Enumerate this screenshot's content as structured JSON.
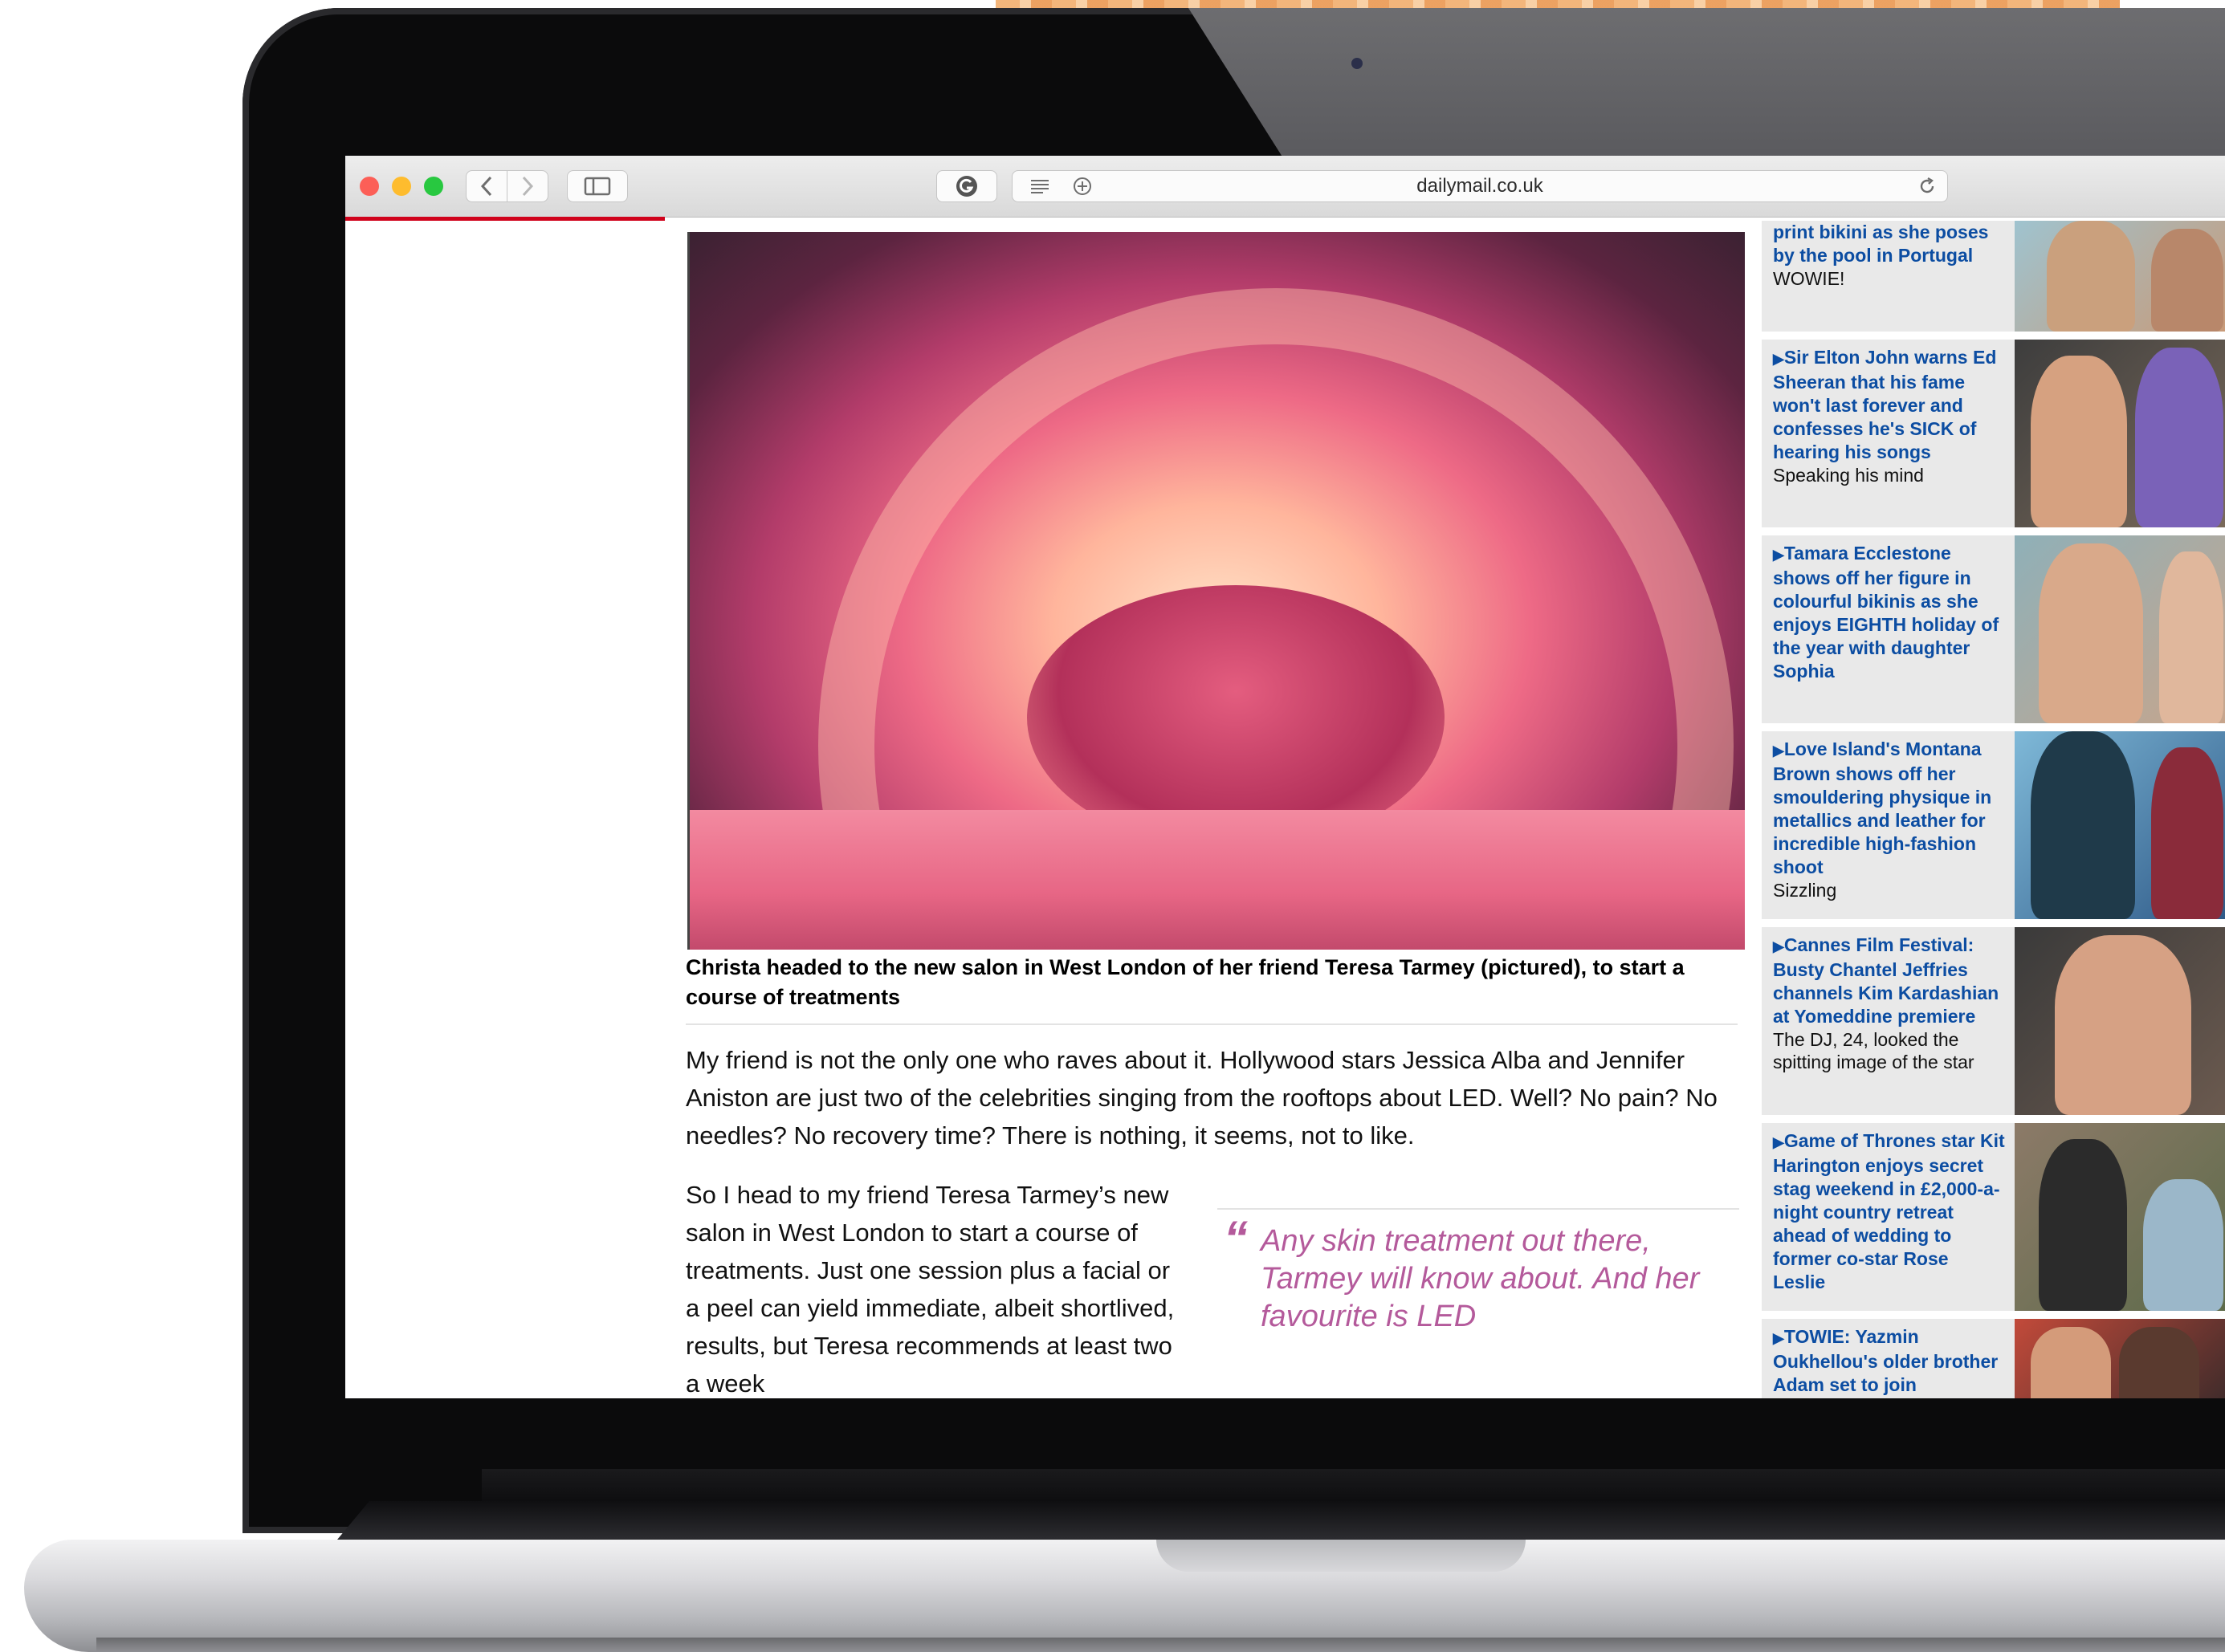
{
  "browser": {
    "url": "dailymail.co.uk",
    "icons": {
      "close": "close-dot",
      "minimize": "minimize-dot",
      "zoom": "zoom-dot",
      "back": "chevron-left-icon",
      "forward": "chevron-right-icon",
      "sidebar": "sidebar-icon",
      "extension": "grammarly-icon",
      "reader": "reader-icon",
      "add": "plus-circle-icon",
      "reload": "reload-icon"
    },
    "load_progress": 0.17
  },
  "article": {
    "caption": "Christa headed to the new salon in West London of her friend Teresa Tarmey (pictured), to start a course of treatments",
    "paragraph1": "My friend is not the only one who raves about it. Hollywood stars Jessica Alba and Jennifer Aniston are just two of the celebrities singing from the rooftops about LED. Well? No pain? No needles? No recovery time? There is nothing, it seems, not to like.",
    "paragraph2": "So I head to my friend Teresa Tarmey’s new salon in West London to start a course of treatments. Just one session plus a facial or a peel can yield immediate, albeit shortlived, results, but Teresa recommends at least two a week",
    "pull_quote": "Any skin treatment out there, Tarmey will know about. And her favourite is LED",
    "quote_open": "“",
    "quote_close": "”"
  },
  "sidebar": {
    "items": [
      {
        "headline": "print bikini as she poses by the pool in Portugal",
        "sub": "WOWIE!"
      },
      {
        "headline": "Sir Elton John warns Ed Sheeran that his fame won't last forever and confesses he's SICK of hearing his songs",
        "sub": "Speaking his mind"
      },
      {
        "headline": "Tamara Ecclestone shows off her figure in colourful bikinis as she enjoys EIGHTH holiday of the year with daughter Sophia",
        "sub": ""
      },
      {
        "headline": "Love Island's Montana Brown shows off her smouldering physique in metallics and leather for incredible high-fashion shoot",
        "sub": "Sizzling"
      },
      {
        "headline": "Cannes Film Festival: Busty Chantel Jeffries channels Kim Kardashian at Yomeddine premiere",
        "sub": "The DJ, 24, looked the spitting image of the star"
      },
      {
        "headline": "Game of Thrones star Kit Harington enjoys secret stag weekend in £2,000-a-night country retreat ahead of wedding to former co-star Rose Leslie",
        "sub": ""
      },
      {
        "headline": "TOWIE: Yazmin Oukhellou's older brother Adam set to join",
        "sub": ""
      }
    ]
  },
  "colors": {
    "link_blue": "#0c4da2",
    "quote_pink": "#b45a9b",
    "progress_red": "#d0021b"
  }
}
